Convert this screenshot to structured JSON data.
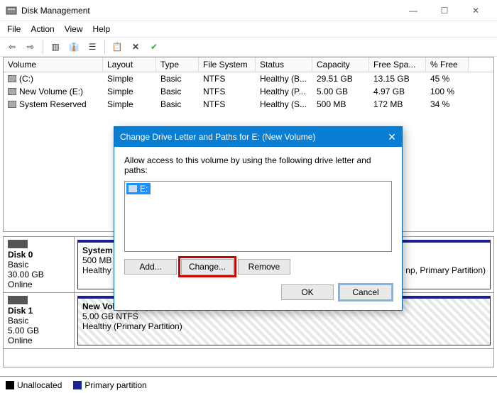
{
  "window": {
    "title": "Disk Management"
  },
  "menu": {
    "file": "File",
    "action": "Action",
    "view": "View",
    "help": "Help"
  },
  "columns": {
    "volume": "Volume",
    "layout": "Layout",
    "type": "Type",
    "fs": "File System",
    "status": "Status",
    "capacity": "Capacity",
    "free": "Free Spa...",
    "pct": "% Free"
  },
  "rows": [
    {
      "vol": "(C:)",
      "lay": "Simple",
      "typ": "Basic",
      "fs": "NTFS",
      "st": "Healthy (B...",
      "cap": "29.51 GB",
      "fr": "13.15 GB",
      "pf": "45 %"
    },
    {
      "vol": "New Volume (E:)",
      "lay": "Simple",
      "typ": "Basic",
      "fs": "NTFS",
      "st": "Healthy (P...",
      "cap": "5.00 GB",
      "fr": "4.97 GB",
      "pf": "100 %"
    },
    {
      "vol": "System Reserved",
      "lay": "Simple",
      "typ": "Basic",
      "fs": "NTFS",
      "st": "Healthy (S...",
      "cap": "500 MB",
      "fr": "172 MB",
      "pf": "34 %"
    }
  ],
  "disks": [
    {
      "name": "Disk 0",
      "type": "Basic",
      "size": "30.00 GB",
      "state": "Online",
      "p1": {
        "title": "System",
        "line2": "500 MB",
        "line3": "Healthy"
      },
      "p2": {
        "line3": "np, Primary Partition)"
      }
    },
    {
      "name": "Disk 1",
      "type": "Basic",
      "size": "5.00 GB",
      "state": "Online",
      "p1": {
        "title": "New Volume  (E:)",
        "line2": "5.00 GB NTFS",
        "line3": "Healthy (Primary Partition)"
      }
    }
  ],
  "legend": {
    "unalloc": "Unallocated",
    "primary": "Primary partition"
  },
  "dialog": {
    "title": "Change Drive Letter and Paths for E: (New Volume)",
    "prompt": "Allow access to this volume by using the following drive letter and paths:",
    "item": "E:",
    "add": "Add...",
    "change": "Change...",
    "remove": "Remove",
    "ok": "OK",
    "cancel": "Cancel"
  }
}
